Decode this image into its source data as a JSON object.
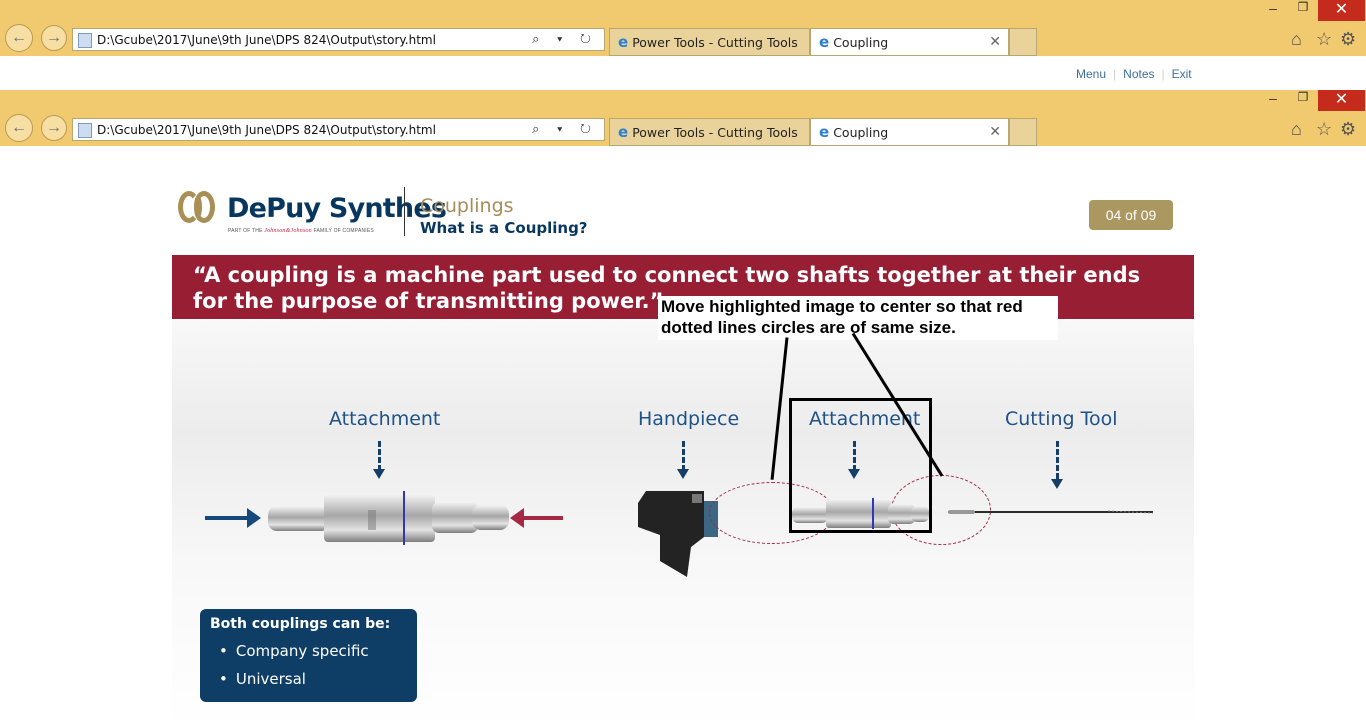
{
  "browser": {
    "address": "D:\\Gcube\\2017\\June\\9th June\\DPS 824\\Output\\story.html",
    "tabs": [
      {
        "label": "Power Tools - Cutting Tools"
      },
      {
        "label": "Coupling"
      }
    ],
    "window_controls": {
      "minimize": "–",
      "maximize": "❐",
      "close": "✕"
    }
  },
  "player_menu": {
    "menu": "Menu",
    "notes": "Notes",
    "exit": "Exit"
  },
  "header": {
    "brand_name": "DePuy Synthes",
    "brand_subtitle_prefix": "PART OF THE",
    "brand_subtitle_mark": "Johnson&Johnson",
    "brand_subtitle_suffix": "FAMILY OF COMPANIES",
    "course_title": "Couplings",
    "lesson_title": "What is a Coupling?",
    "page_counter": "04 of 09"
  },
  "content": {
    "quote": "“A coupling is a machine part used to connect two shafts together at their ends for the purpose of transmitting power.”",
    "annotation": "Move highlighted image to center so that red dotted lines circles are of same size.",
    "labels": {
      "attachment_left": "Attachment",
      "handpiece": "Handpiece",
      "attachment_right": "Attachment",
      "cutting_tool": "Cutting Tool"
    },
    "info_box": {
      "title": "Both couplings can be:",
      "items": [
        "Company specific",
        "Universal"
      ]
    }
  },
  "colors": {
    "chrome": "#f1c96f",
    "brand_blue": "#07365f",
    "brand_gold": "#a88f55",
    "quote_red": "#981e34"
  }
}
